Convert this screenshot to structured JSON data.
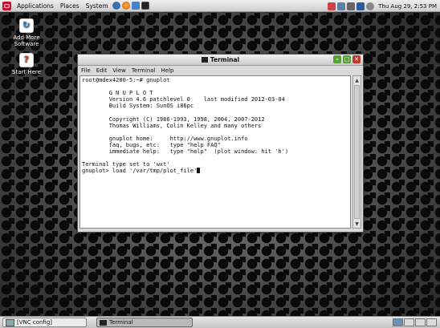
{
  "top_panel": {
    "menus": [
      "Applications",
      "Places",
      "System"
    ],
    "launchers": [
      "help-icon",
      "browser-icon",
      "mail-icon",
      "terminal-icon"
    ],
    "tray_icons": [
      "update-icon",
      "network-icon",
      "volume-icon",
      "user-icon",
      "power-icon"
    ],
    "clock": "Thu Aug 29,  2:53 PM"
  },
  "desktop": {
    "icons": [
      {
        "label": "Add More Software",
        "icon": "add-software-icon"
      },
      {
        "label": "Start Here",
        "icon": "help-icon"
      }
    ]
  },
  "terminal": {
    "title": "Terminal",
    "menu": [
      "File",
      "Edit",
      "View",
      "Terminal",
      "Help"
    ],
    "lines": [
      "root@mdex4200-5:~# gnuplot",
      "",
      "        G N U P L O T",
      "        Version 4.6 patchlevel 0    last modified 2012-03-04",
      "        Build System: SunOS i86pc",
      "",
      "        Copyright (C) 1986-1993, 1998, 2004, 2007-2012",
      "        Thomas Williams, Colin Kelley and many others",
      "",
      "        gnuplot home:     http://www.gnuplot.info",
      "        faq, bugs, etc:   type \"help FAQ\"",
      "        immediate help:   type \"help\"  (plot window: hit 'h')",
      "",
      "Terminal type set to 'wxt'",
      "gnuplot> load '/var/tmp/plot_file'"
    ]
  },
  "taskbar": {
    "tasks": [
      {
        "label": "[VNC config]",
        "active": false
      },
      {
        "label": "Terminal",
        "active": true
      }
    ],
    "workspaces": 4,
    "active_workspace": 1
  },
  "colors": {
    "oracle_red": "#c8102e",
    "close_button": "#c0392b",
    "min_max_button": "#5a9e3a"
  }
}
